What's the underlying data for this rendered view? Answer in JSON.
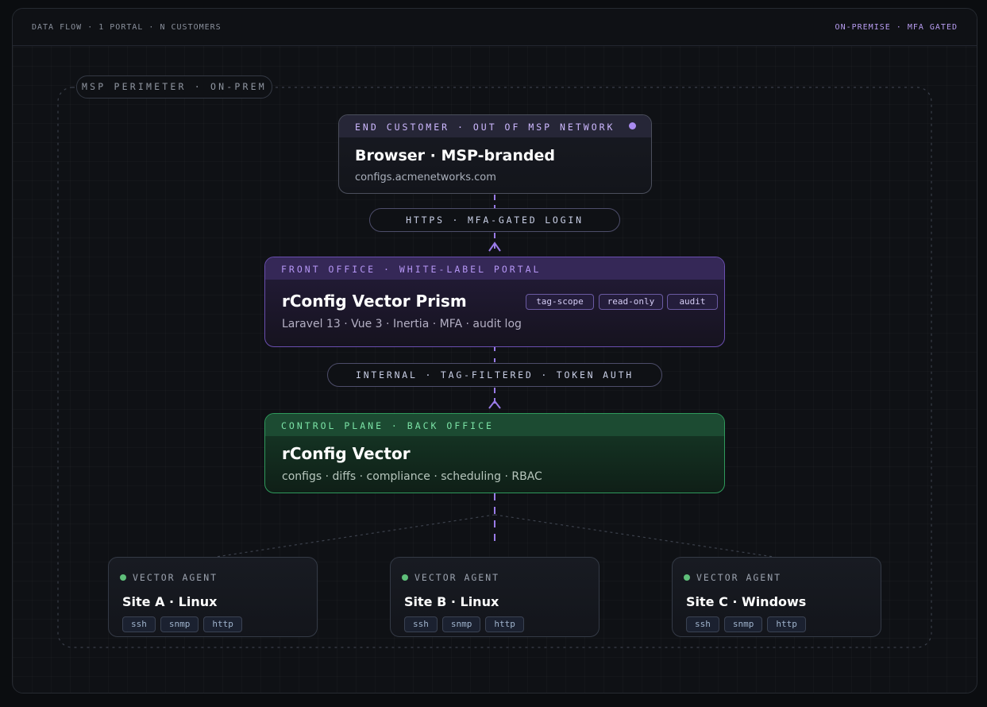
{
  "header": {
    "left": "DATA FLOW · 1 PORTAL · N CUSTOMERS",
    "right": "ON-PREMISE · MFA GATED"
  },
  "perimeter": {
    "label": "MSP PERIMETER · ON-PREM"
  },
  "browser": {
    "head": "END CUSTOMER · OUT OF MSP NETWORK",
    "title": "Browser · MSP-branded",
    "subtitle": "configs.acmenetworks.com"
  },
  "link_https": "HTTPS · MFA-GATED LOGIN",
  "prism": {
    "head": "FRONT OFFICE · WHITE-LABEL PORTAL",
    "title": "rConfig Vector Prism",
    "subtitle": "Laravel 13 · Vue 3 · Inertia · MFA · audit log",
    "chips": [
      "tag-scope",
      "read-only",
      "audit"
    ]
  },
  "link_internal": "INTERNAL · TAG-FILTERED · TOKEN AUTH",
  "vector": {
    "head": "CONTROL PLANE · BACK OFFICE",
    "title": "rConfig Vector",
    "subtitle": "configs · diffs · compliance · scheduling · RBAC"
  },
  "agents": [
    {
      "head": "VECTOR AGENT",
      "title": "Site A · Linux",
      "tags": [
        "ssh",
        "snmp",
        "http"
      ]
    },
    {
      "head": "VECTOR AGENT",
      "title": "Site B · Linux",
      "tags": [
        "ssh",
        "snmp",
        "http"
      ]
    },
    {
      "head": "VECTOR AGENT",
      "title": "Site C · Windows",
      "tags": [
        "ssh",
        "snmp",
        "http"
      ]
    }
  ],
  "colors": {
    "accent_purple": "#a98bf0",
    "accent_green": "#2f9a5c",
    "agent_status": "#5fbf7a"
  }
}
